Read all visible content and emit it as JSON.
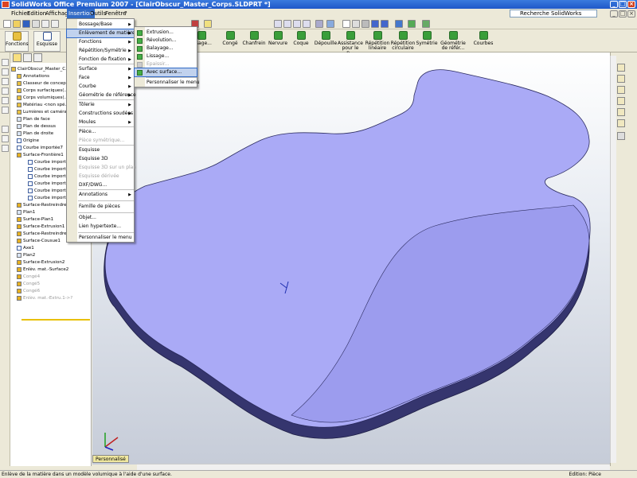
{
  "window": {
    "title": "SolidWorks Office Premium 2007 - [ClairObscur_Master_Corps.SLDPRT *]"
  },
  "menubar": {
    "items": [
      "Fichier",
      "Edition",
      "Affichage",
      "Insertion",
      "Outils",
      "Fenêtre",
      "?"
    ],
    "search_label": "Recherche SolidWorks"
  },
  "toolbar": {
    "left_buttons": [
      "Fonctions",
      "Esquisse"
    ],
    "right_buttons": [
      "Congé",
      "Chanfrein",
      "Nervure",
      "Coque",
      "Dépouille",
      "Assistance pour le p...",
      "Répétition linéaire",
      "Répétition circulaire",
      "Symétrie",
      "Géométrie de référ...",
      "Courbes"
    ],
    "partial_label": "...sage..."
  },
  "insertion_menu": {
    "items": [
      {
        "label": "Bossage/Base",
        "arrow": true
      },
      {
        "label": "Enlèvement de matière",
        "arrow": true,
        "highlight": true
      },
      {
        "label": "Fonctions",
        "arrow": true
      },
      {
        "label": "Répétition/Symétrie",
        "arrow": true
      },
      {
        "label": "Fonction de fixation",
        "arrow": true
      },
      {
        "label": "Surface",
        "arrow": true
      },
      {
        "label": "Face",
        "arrow": true
      },
      {
        "label": "Courbe",
        "arrow": true
      },
      {
        "label": "Géométrie de référence",
        "arrow": true
      },
      {
        "label": "Tôlerie",
        "arrow": true
      },
      {
        "label": "Constructions soudées",
        "arrow": true
      },
      {
        "label": "Moules",
        "arrow": true
      },
      {
        "label": "Pièce...",
        "arrow": false
      },
      {
        "label": "Pièce symétrique...",
        "arrow": false,
        "disabled": true
      },
      {
        "label": "Esquisse",
        "arrow": false
      },
      {
        "label": "Esquisse 3D",
        "arrow": false
      },
      {
        "label": "Esquisse 3D sur un plan",
        "arrow": false,
        "disabled": true
      },
      {
        "label": "Esquisse dérivée",
        "arrow": false,
        "disabled": true
      },
      {
        "label": "DXF/DWG...",
        "arrow": false
      },
      {
        "label": "Annotations",
        "arrow": true
      },
      {
        "label": "Famille de pièces",
        "arrow": false
      },
      {
        "label": "Objet...",
        "arrow": false
      },
      {
        "label": "Lien hypertexte...",
        "arrow": false
      },
      {
        "label": "Personnaliser le menu",
        "arrow": false
      }
    ]
  },
  "enlevement_submenu": {
    "items": [
      {
        "label": "Extrusion...",
        "disabled": false
      },
      {
        "label": "Révolution...",
        "disabled": false
      },
      {
        "label": "Balayage...",
        "disabled": false
      },
      {
        "label": "Lissage...",
        "disabled": false
      },
      {
        "label": "Epaissir...",
        "disabled": true
      },
      {
        "label": "Avec surface...",
        "disabled": false,
        "highlight": true
      },
      {
        "label": "Personnaliser le menu",
        "disabled": false
      }
    ]
  },
  "feature_tree": {
    "root": "ClairObscur_Master_C...",
    "rows": [
      {
        "label": "Annotations",
        "type": "folder",
        "dim": false
      },
      {
        "label": "Classeur de concep...",
        "type": "folder",
        "dim": false
      },
      {
        "label": "Corps surfaciques(...",
        "type": "folder",
        "dim": false
      },
      {
        "label": "Corps volumiques(...",
        "type": "folder",
        "dim": false
      },
      {
        "label": "Matériau <non spé...",
        "type": "folder",
        "dim": false
      },
      {
        "label": "Lumières et caméra...",
        "type": "folder",
        "dim": false
      },
      {
        "label": "Plan de face",
        "type": "plane",
        "dim": false
      },
      {
        "label": "Plan de dessus",
        "type": "plane",
        "dim": false
      },
      {
        "label": "Plan de droite",
        "type": "plane",
        "dim": false
      },
      {
        "label": "Origine",
        "type": "sketch",
        "dim": false
      },
      {
        "label": "Courbe importée7",
        "type": "sketch",
        "dim": false
      },
      {
        "label": "Surface-Frontière1",
        "type": "surface",
        "dim": false
      },
      {
        "label": "Courbe importé...",
        "type": "sketch",
        "dim": false
      },
      {
        "label": "Courbe importé...",
        "type": "sketch",
        "dim": false
      },
      {
        "label": "Courbe importé...",
        "type": "sketch",
        "dim": false
      },
      {
        "label": "Courbe importé...",
        "type": "sketch",
        "dim": false
      },
      {
        "label": "Courbe importé...",
        "type": "sketch",
        "dim": false
      },
      {
        "label": "Courbe importé...",
        "type": "sketch",
        "dim": false
      },
      {
        "label": "Surface-Restreindre...",
        "type": "surface",
        "dim": false
      },
      {
        "label": "Plan1",
        "type": "plane",
        "dim": false
      },
      {
        "label": "Surface-Plan1",
        "type": "surface",
        "dim": false
      },
      {
        "label": "Surface-Extrusion1",
        "type": "surface",
        "dim": false
      },
      {
        "label": "Surface-Restreindre...",
        "type": "surface",
        "dim": false
      },
      {
        "label": "Surface-Cousue1",
        "type": "surface",
        "dim": false
      },
      {
        "label": "Axe1",
        "type": "sketch",
        "dim": false
      },
      {
        "label": "Plan2",
        "type": "plane",
        "dim": false
      },
      {
        "label": "Surface-Extrusion2",
        "type": "surface",
        "dim": false
      },
      {
        "label": "Enlèv. mat.-Surface2",
        "type": "surface",
        "dim": false
      },
      {
        "label": "Congé4",
        "type": "surface",
        "dim": true
      },
      {
        "label": "Congé5",
        "type": "surface",
        "dim": true
      },
      {
        "label": "Congé6",
        "type": "surface",
        "dim": true
      },
      {
        "label": "Enlèv. mat.-Extru.1->?",
        "type": "surface",
        "dim": true
      }
    ]
  },
  "tabs": {
    "active": "Personnalisé"
  },
  "status": {
    "message": "Enlève de la matière dans un modèle volumique à l'aide d'une surface.",
    "mode": "Edition: Pièce"
  },
  "colors": {
    "model_face": "#aaaaf6",
    "model_side": "#35356e",
    "highlight": "#316ac5",
    "menu_bg": "#ffffff"
  }
}
